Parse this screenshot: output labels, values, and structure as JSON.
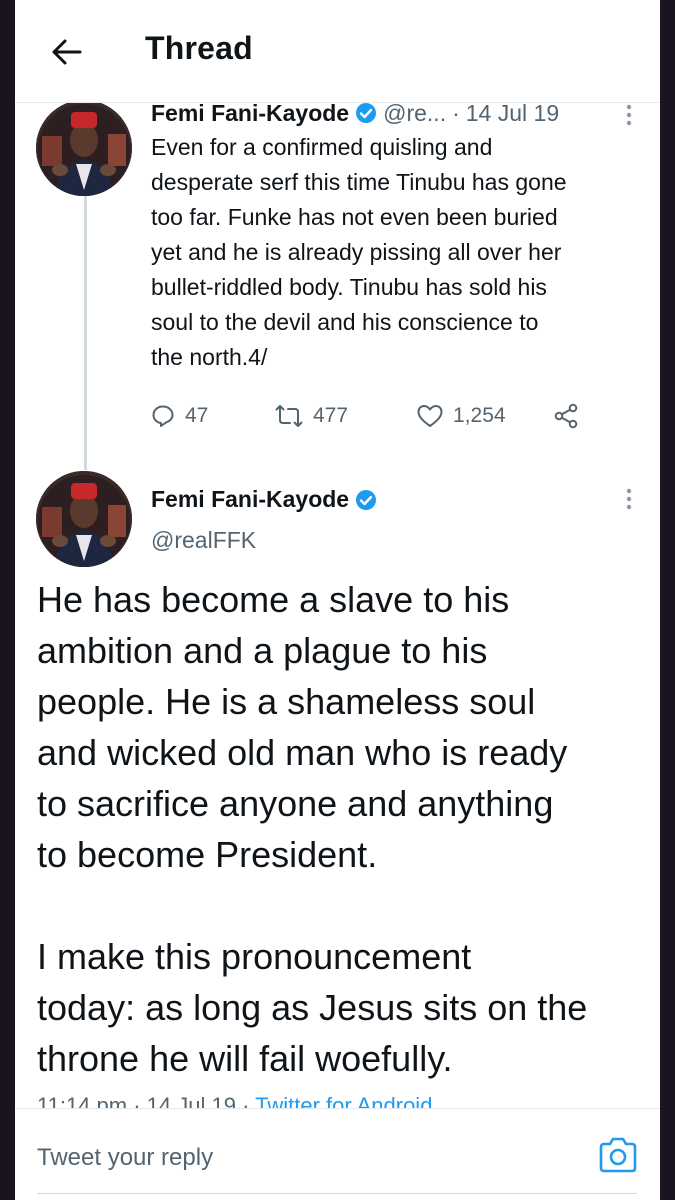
{
  "header": {
    "title": "Thread"
  },
  "tweet1": {
    "name": "Femi Fani-Kayode",
    "handle": "@re...",
    "separator": "·",
    "date": "14 Jul 19",
    "text": "Even for a confirmed quisling and\ndesperate serf this time Tinubu has gone\ntoo far. Funke has not even been buried\nyet and he is already pissing all over her\nbullet-riddled body. Tinubu has sold his\nsoul to the devil and his conscience to\nthe north.4/",
    "replies": "47",
    "retweets": "477",
    "likes": "1,254"
  },
  "tweet2": {
    "name": "Femi Fani-Kayode",
    "handle": "@realFFK",
    "text": "He has become a slave to his\nambition and a plague to his\npeople. He is a shameless soul\nand wicked old man who is ready\nto sacrifice anyone and anything\nto become President.\n\nI make this pronouncement\ntoday: as long as Jesus sits on the\nthrone he will fail woefully.",
    "time": "11:14 pm",
    "date": "14 Jul 19",
    "source": "Twitter for Android",
    "sep": " · "
  },
  "reply": {
    "placeholder": "Tweet your reply"
  },
  "colors": {
    "accent": "#1d9bf0",
    "muted": "#536471",
    "text": "#0f1419"
  },
  "icons": [
    "back-arrow-icon",
    "verified-badge-icon",
    "more-options-icon",
    "reply-icon",
    "retweet-icon",
    "like-icon",
    "share-icon",
    "camera-icon"
  ]
}
